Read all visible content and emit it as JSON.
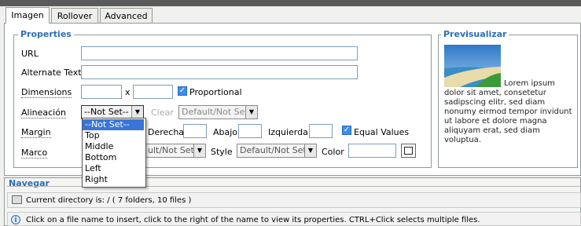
{
  "tabs": [
    {
      "label": "Imagen",
      "active": true
    },
    {
      "label": "Rollover",
      "active": false
    },
    {
      "label": "Advanced",
      "active": false
    }
  ],
  "properties": {
    "legend": "Properties",
    "url_label": "URL",
    "url_value": "",
    "alt_label": "Alternate Text",
    "alt_value": "",
    "dimensions_label": "Dimensions",
    "width_value": "",
    "times": "x",
    "height_value": "",
    "proportional_label": "Proportional",
    "proportional_checked": true,
    "alignment_label": "Alineación",
    "alignment_selected": "--Not Set--",
    "clear_label": "Clear",
    "clear_selected": "Default/Not Set",
    "margin_label": "Margin",
    "derecha_label": "Derecha",
    "abajo_label": "Abajo",
    "izquierda_label": "Izquierda",
    "equal_values_label": "Equal Values",
    "equal_values_checked": true,
    "marco_label": "Marco",
    "border_width_selected": "ult/Not Set",
    "style_label": "Style",
    "style_selected": "Default/Not Set",
    "color_label": "Color",
    "color_value": ""
  },
  "alignment_dropdown": {
    "options": [
      "--Not Set--",
      "Top",
      "Middle",
      "Bottom",
      "Left",
      "Right"
    ],
    "highlighted": "--Not Set--"
  },
  "preview": {
    "legend": "Previsualizar",
    "text": "Lorem ipsum dolor sit amet, consetetur sadipscing elitr, sed diam nonumy eirmod tempor invidunt ut labore et dolore magna aliquyam erat, sed diam voluptua."
  },
  "navegar": {
    "legend": "Navegar",
    "current_dir": "Current directory is: / ( 7 folders, 10 files )",
    "info": "Click on a file name to insert, click to the right of the name to view its properties. CTRL+Click selects multiple files."
  },
  "colors": {
    "legend": "#2b6fb6",
    "highlight": "#3875d7",
    "checkbox": "#3d8ee8"
  }
}
